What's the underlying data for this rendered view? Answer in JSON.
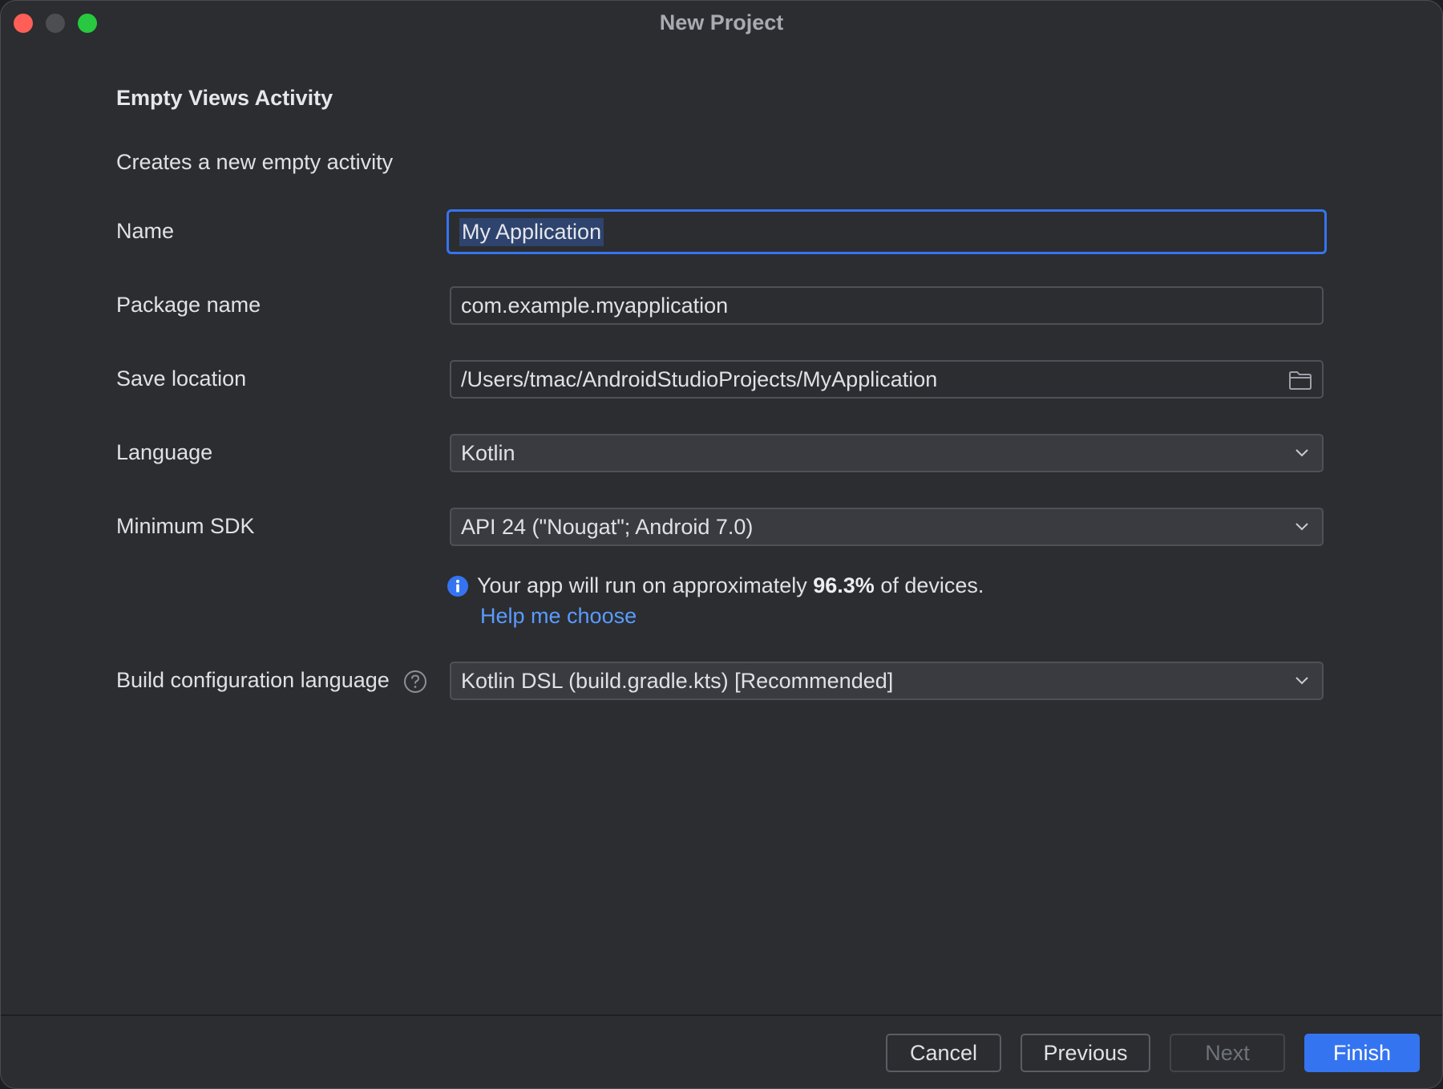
{
  "window": {
    "title": "New Project"
  },
  "template": {
    "name": "Empty Views Activity",
    "description": "Creates a new empty activity"
  },
  "form": {
    "name": {
      "label": "Name",
      "value": "My Application"
    },
    "package_name": {
      "label": "Package name",
      "value": "com.example.myapplication"
    },
    "save_location": {
      "label": "Save location",
      "value": "/Users/tmac/AndroidStudioProjects/MyApplication",
      "icon": "folder-icon"
    },
    "language": {
      "label": "Language",
      "value": "Kotlin"
    },
    "minimum_sdk": {
      "label": "Minimum SDK",
      "value": "API 24 (\"Nougat\"; Android 7.0)"
    },
    "sdk_info": {
      "prefix": "Your app will run on approximately ",
      "percent": "96.3%",
      "suffix": " of devices.",
      "link": "Help me choose",
      "icon": "info-icon"
    },
    "build_config_language": {
      "label": "Build configuration language",
      "value": "Kotlin DSL (build.gradle.kts) [Recommended]",
      "icon": "help-icon"
    }
  },
  "buttons": {
    "cancel": "Cancel",
    "previous": "Previous",
    "next": "Next",
    "finish": "Finish"
  },
  "colors": {
    "accent": "#3574f0",
    "link": "#5a9bff",
    "background": "#2b2d30",
    "close": "#ff5f57",
    "zoom": "#28c840"
  }
}
